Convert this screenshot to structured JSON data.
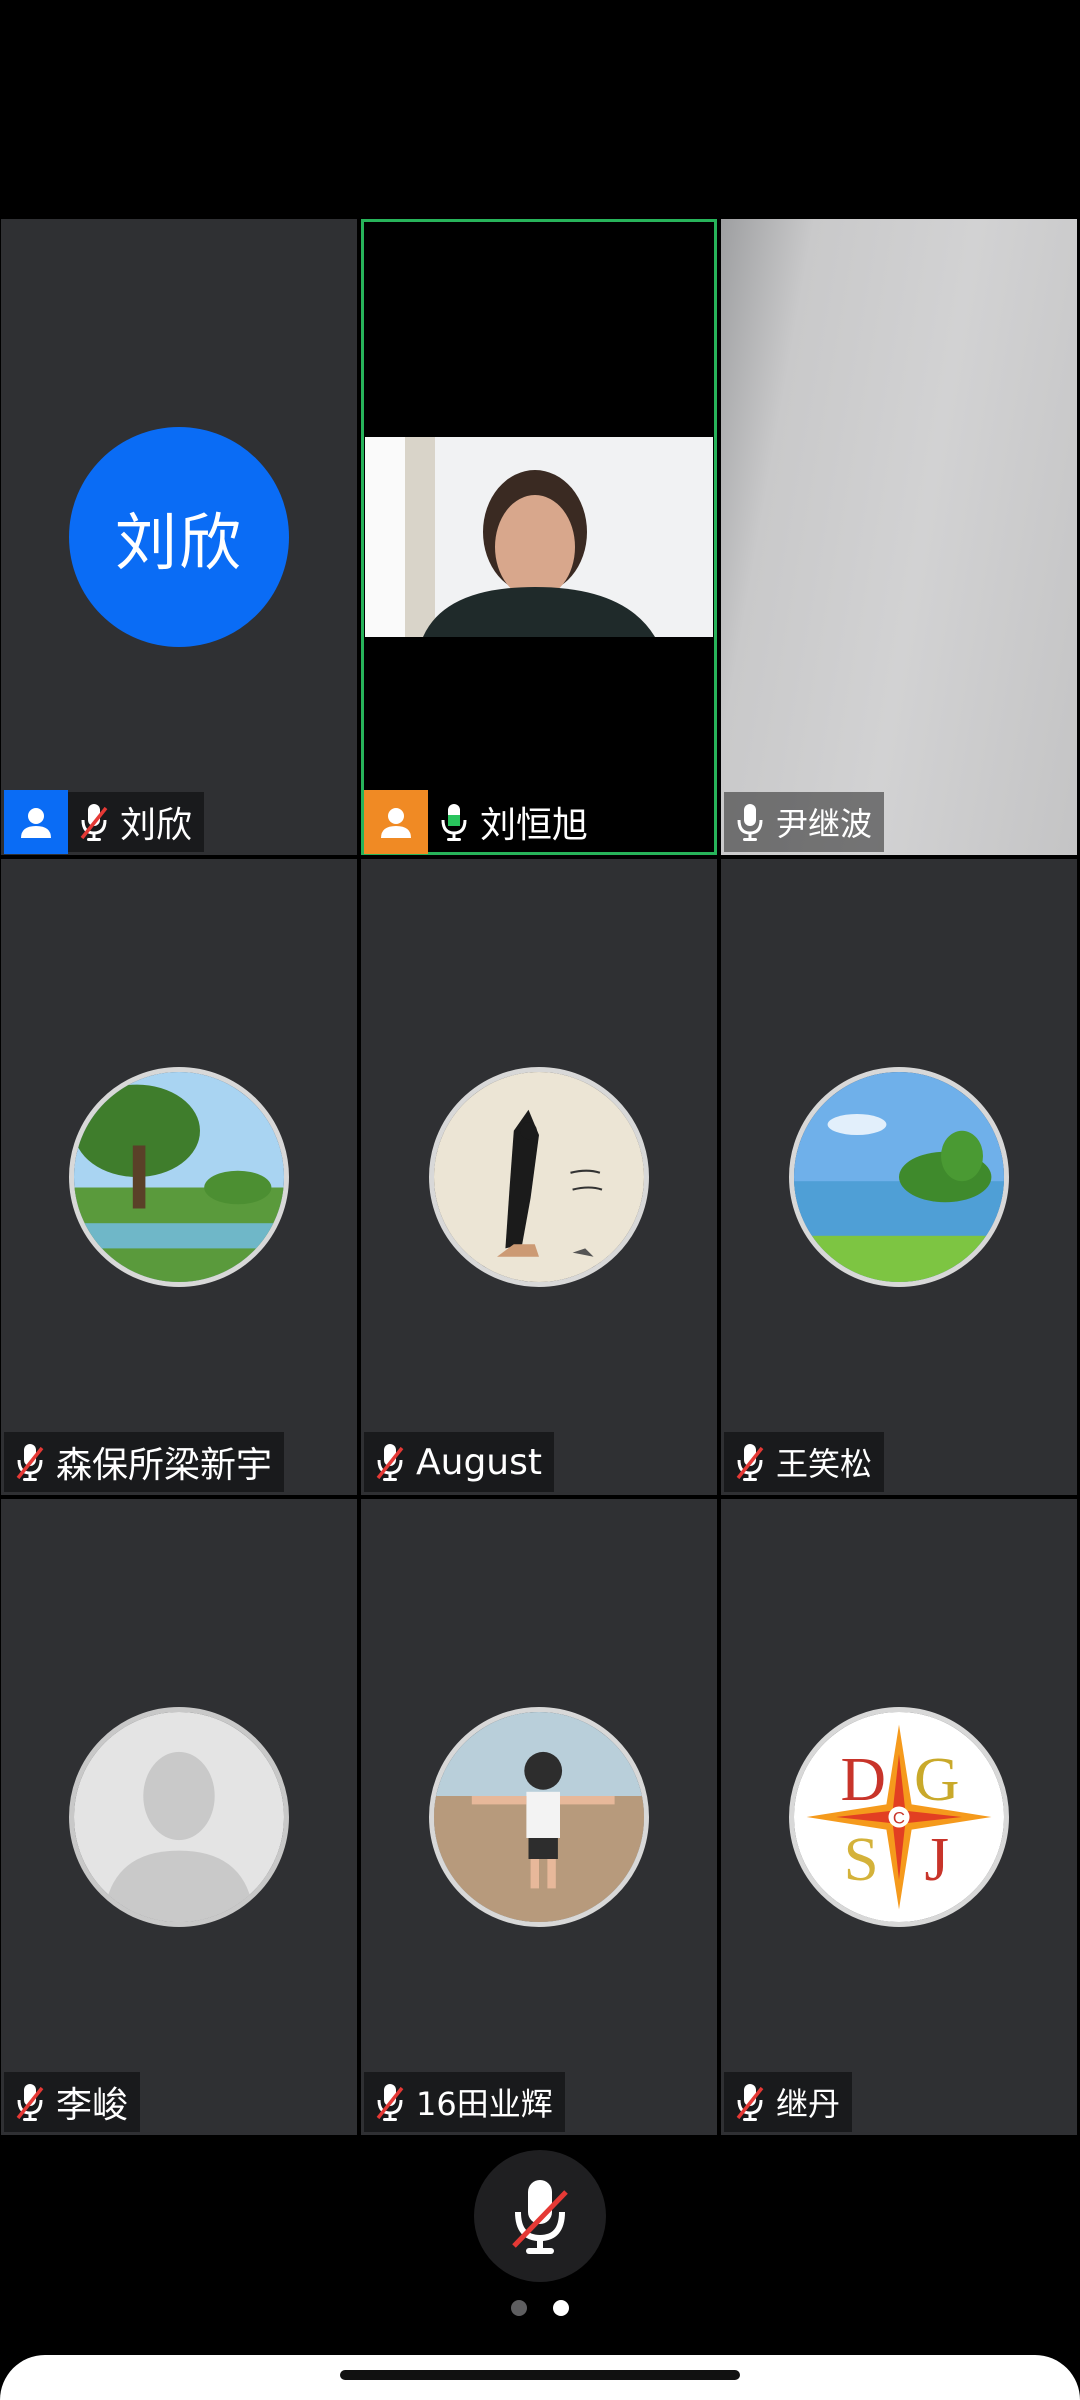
{
  "participants": [
    {
      "name": "刘欣",
      "avatar_text": "刘欣",
      "mic": "muted",
      "role": "host",
      "badge_color": "#0a6cf5"
    },
    {
      "name": "刘恒旭",
      "mic": "active",
      "role": "co-host",
      "badge_color": "#f08a24",
      "speaking": true
    },
    {
      "name": "尹继波",
      "mic": "on"
    },
    {
      "name": "森保所梁新宇",
      "mic": "muted",
      "avatar": "landscape-tree-photo"
    },
    {
      "name": "August",
      "mic": "muted",
      "avatar": "woman-figure-drawing"
    },
    {
      "name": "王笑松",
      "mic": "muted",
      "avatar": "lake-island-photo"
    },
    {
      "name": "李峻",
      "mic": "muted",
      "avatar": "default-person"
    },
    {
      "name": "16田业辉",
      "mic": "muted",
      "avatar": "child-beach-photo"
    },
    {
      "name": "继丹",
      "mic": "muted",
      "avatar": "dgsj-logo",
      "logo_text": [
        "D",
        "G",
        "S",
        "J",
        "C"
      ]
    }
  ],
  "controls": {
    "mute_button": "muted-microphone-icon"
  },
  "pagination": {
    "pages": 2,
    "current": 2
  },
  "colors": {
    "host_blue": "#0a6cf5",
    "cohost_orange": "#f08a24",
    "speaking_green": "#27b35a",
    "tile_bg": "#2f3033"
  }
}
